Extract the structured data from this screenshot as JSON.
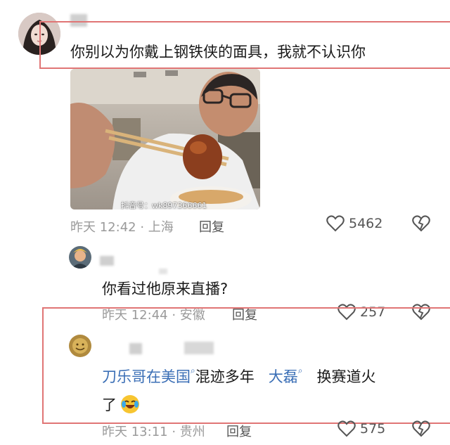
{
  "comments": [
    {
      "text": "你别以为你戴上钢铁侠的面具，我就不认识你",
      "time": "昨天 12:42 · 上海",
      "reply_label": "回复",
      "likes": "5462",
      "video": {
        "watermark": "抖音号：wk897366661"
      }
    },
    {
      "text": "你看过他原来直播?",
      "time": "昨天 12:44 · 安徽",
      "reply_label": "回复",
      "likes": "257"
    },
    {
      "text_part1": "刀乐哥在美国",
      "text_part2": "混迹多年",
      "text_part3": "大磊",
      "text_part4": "换赛道火",
      "text_line2": "了",
      "time": "昨天 13:11 · 贵州",
      "reply_label": "回复",
      "likes": "575"
    }
  ],
  "icons": {
    "heart": "heart-icon",
    "dislike": "broken-heart-icon",
    "search": "search-icon",
    "emoji": "laughing-emoji"
  },
  "colors": {
    "highlight_box": "#e07575",
    "link": "#3b6fb6",
    "meta": "#9a9a9a"
  }
}
